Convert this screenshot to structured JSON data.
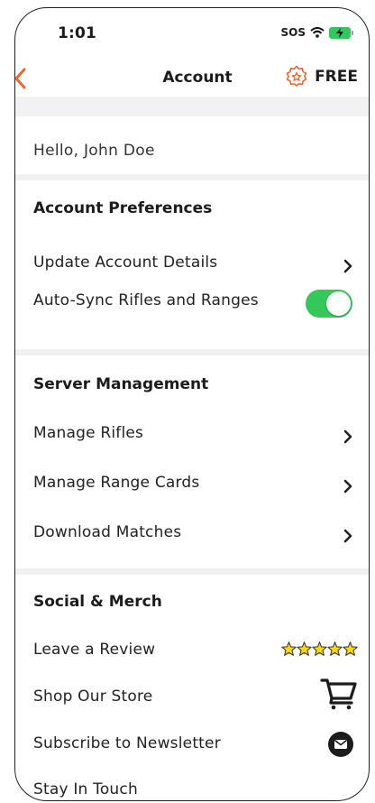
{
  "status_bar": {
    "time": "1:01",
    "sos": "SOS"
  },
  "nav": {
    "title": "Account",
    "plan": "FREE",
    "accent_color": "#f0642d"
  },
  "greeting": "Hello,  John Doe",
  "sections": {
    "account": {
      "title": "Account Preferences",
      "update_details": "Update Account Details",
      "auto_sync": "Auto-Sync Rifles and Ranges",
      "auto_sync_on": true
    },
    "server": {
      "title": "Server Management",
      "manage_rifles": "Manage Rifles",
      "manage_range_cards": "Manage Range Cards",
      "download_matches": "Download Matches"
    },
    "social": {
      "title": "Social & Merch",
      "review": "Leave a Review",
      "review_rating": 5,
      "store": "Shop Our Store",
      "newsletter": "Subscribe to Newsletter",
      "touch": "Stay In Touch"
    }
  },
  "icons": [
    "back-chevron-icon",
    "star-badge-icon",
    "chevron-right-icon",
    "star-icon",
    "cart-icon",
    "mail-icon",
    "wifi-icon",
    "battery-charging-icon"
  ]
}
